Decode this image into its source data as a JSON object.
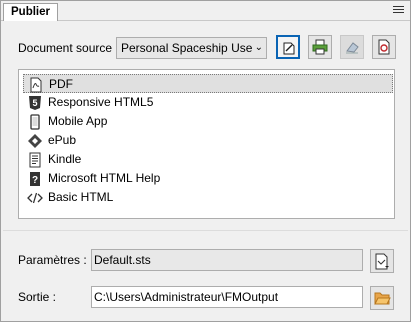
{
  "window": {
    "tab_title": "Publier"
  },
  "source": {
    "label": "Document source :",
    "selected": "Personal Spaceship User Guide"
  },
  "toolbar": {
    "buttons": [
      {
        "name": "edit-publication-button",
        "icon": "edit-document-icon"
      },
      {
        "name": "print-button",
        "icon": "printer-icon"
      },
      {
        "name": "clean-button",
        "icon": "eraser-icon"
      },
      {
        "name": "preview-pdf-button",
        "icon": "pdf-preview-icon"
      }
    ]
  },
  "formats": {
    "items": [
      {
        "label": "PDF",
        "icon": "pdf-file-icon",
        "selected": true
      },
      {
        "label": "Responsive HTML5",
        "icon": "html5-icon"
      },
      {
        "label": "Mobile App",
        "icon": "mobile-phone-icon"
      },
      {
        "label": "ePub",
        "icon": "epub-icon"
      },
      {
        "label": "Kindle",
        "icon": "kindle-icon"
      },
      {
        "label": "Microsoft HTML Help",
        "icon": "html-help-icon"
      },
      {
        "label": "Basic HTML",
        "icon": "code-brackets-icon"
      }
    ]
  },
  "settings": {
    "label": "Paramètres :",
    "value": "Default.sts"
  },
  "output": {
    "label": "Sortie :",
    "value": "C:\\Users\\Administrateur\\FMOutput"
  },
  "colors": {
    "accent": "#0a64b4",
    "selection": "#e0e0e0"
  }
}
